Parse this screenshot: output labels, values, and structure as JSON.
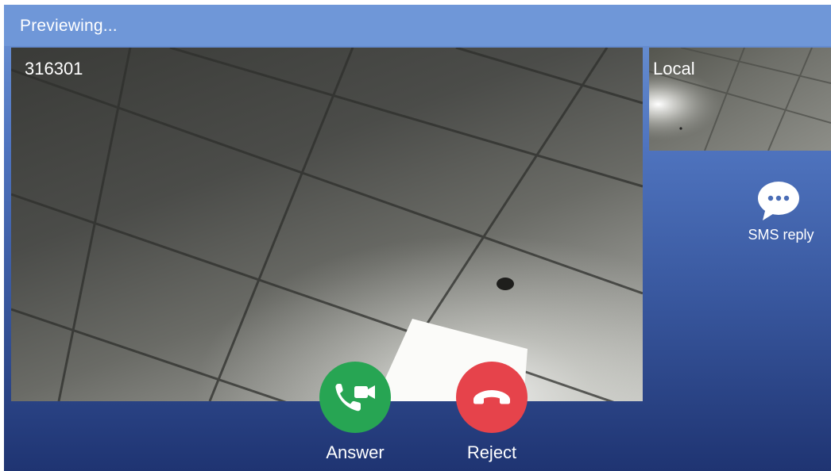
{
  "status": {
    "text": "Previewing..."
  },
  "remote": {
    "number": "316301"
  },
  "local": {
    "label": "Local"
  },
  "sms": {
    "label": "SMS reply",
    "icon": "chat-bubble-icon"
  },
  "actions": {
    "answer": {
      "label": "Answer",
      "icon": "video-call-answer-icon",
      "color": "#27a553"
    },
    "reject": {
      "label": "Reject",
      "icon": "hang-up-icon",
      "color": "#e6434b"
    }
  },
  "colors": {
    "status_bar": "#6f97d8",
    "background_top": "#6d95d6",
    "background_bottom": "#1f3472"
  }
}
